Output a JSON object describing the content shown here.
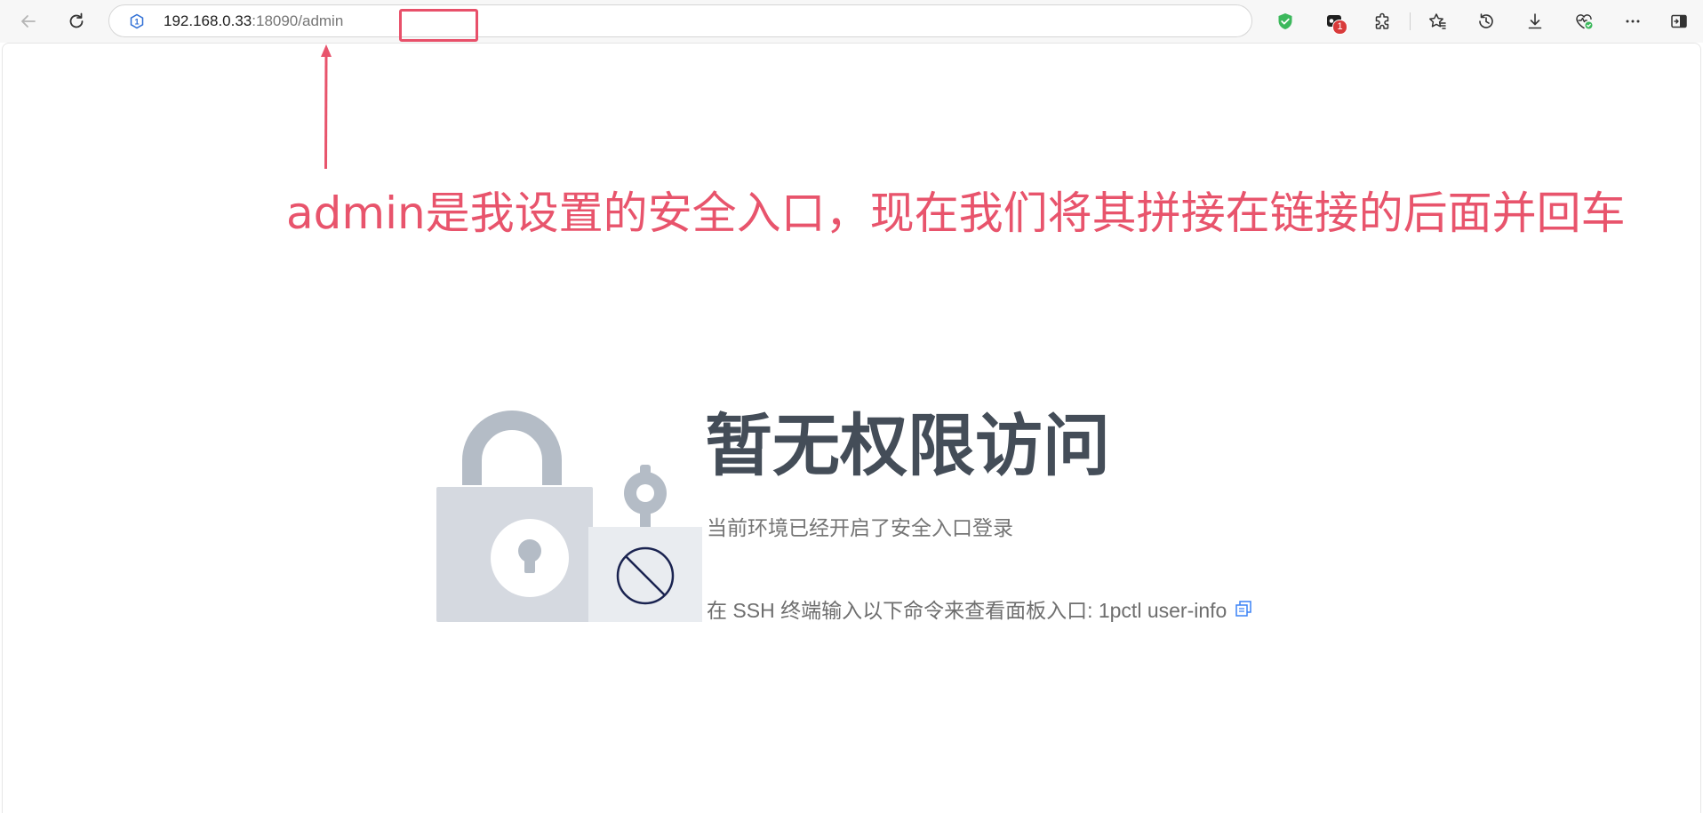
{
  "browser": {
    "url_host": "192.168.0.33",
    "url_port": ":18090",
    "url_path": "/admin",
    "extension_badge_count": "1",
    "icons": [
      "back-icon",
      "refresh-icon",
      "site-info-icon",
      "shield-check-icon",
      "extension-badge-icon",
      "puzzle-icon",
      "favorites-icon",
      "history-icon",
      "download-icon",
      "browser-essentials-icon",
      "more-icon",
      "sidebar-icon"
    ]
  },
  "annotation": {
    "text": "admin是我设置的安全入口，现在我们将其拼接在链接的后面并回车",
    "color": "#e8546c"
  },
  "page": {
    "title": "暂无权限访问",
    "description": "当前环境已经开启了安全入口登录",
    "ssh_hint": "在 SSH 终端输入以下命令来查看面板入口: 1pctl user-info",
    "copy_icon": "copy-icon"
  },
  "colors": {
    "title": "#444d58",
    "lock": "#d5d9e0",
    "lock_shackle": "#b4bcc6",
    "accent": "#3b82f6"
  }
}
